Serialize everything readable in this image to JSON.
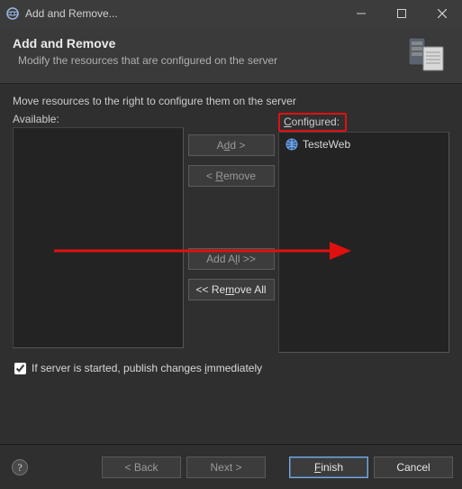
{
  "window": {
    "title": "Add and Remove..."
  },
  "header": {
    "title": "Add and Remove",
    "subtitle": "Modify the resources that are configured on the server"
  },
  "body": {
    "instruction": "Move resources to the right to configure them on the server",
    "available_label": "Available:",
    "configured_label": "Configured:",
    "configured_items": [
      {
        "name": "TesteWeb"
      }
    ],
    "btn_add": "Add >",
    "btn_remove": "< Remove",
    "btn_add_all": "Add All >>",
    "btn_remove_all": "<< Remove All",
    "publish_label": "If server is started, publish changes immediately"
  },
  "footer": {
    "back": "< Back",
    "next": "Next >",
    "finish": "Finish",
    "cancel": "Cancel"
  }
}
